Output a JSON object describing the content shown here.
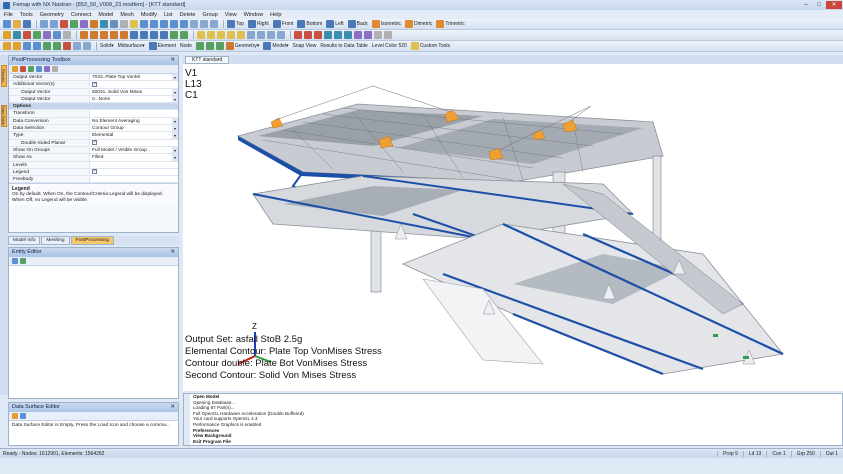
{
  "title": "Femap with NX Nastran - [853_50_V008_23.modfem] - [KTT standard]",
  "window_controls": {
    "minimize": "–",
    "maximize": "□",
    "close": "✕"
  },
  "menu": [
    "File",
    "Tools",
    "Geometry",
    "Connect",
    "Model",
    "Mesh",
    "Modify",
    "List",
    "Delete",
    "Group",
    "View",
    "Window",
    "Help"
  ],
  "toolbar1": {
    "views": [
      "Top",
      "Right",
      "Front",
      "Bottom",
      "Left",
      "Back",
      "Isometric",
      "Dimetric",
      "Trimetric"
    ]
  },
  "toolbar3": {
    "items": [
      "Solid",
      "Midsurface",
      "Element",
      "Node",
      "Geometry",
      "Model",
      "Snap View",
      "Results to Data Table",
      "Level Color 520",
      "Custom Tools"
    ]
  },
  "side_tabs": [
    "Results",
    "Data Table"
  ],
  "postprocessing_toolbox": {
    "title": "PostProcessing Toolbox",
    "rows": [
      {
        "key": "Output Vector",
        "value": "7033..Plate Top VonMi",
        "indent": false,
        "type": "text"
      },
      {
        "key": "Additional Vector(s)",
        "value": "",
        "indent": false,
        "type": "check"
      },
      {
        "key": "Output Vector",
        "value": "60031..Solid Von Mises",
        "indent": true,
        "type": "text"
      },
      {
        "key": "Output Vector",
        "value": "0...None",
        "indent": true,
        "type": "text"
      },
      {
        "key": "Options",
        "value": "",
        "indent": false,
        "type": "section"
      },
      {
        "key": "Transform",
        "value": "",
        "indent": false,
        "type": "text"
      },
      {
        "key": "Data Conversion",
        "value": "No Element Averaging",
        "indent": false,
        "type": "text"
      },
      {
        "key": "Data Selection",
        "value": "Contour Group",
        "indent": false,
        "type": "text"
      },
      {
        "key": "Type",
        "value": "Elemental",
        "indent": false,
        "type": "text"
      },
      {
        "key": "Double-Sided Planar",
        "value": "",
        "indent": true,
        "type": "check"
      },
      {
        "key": "Show On Groups",
        "value": "Full Model / Visible Group",
        "indent": false,
        "type": "text"
      },
      {
        "key": "Show As",
        "value": "Filled",
        "indent": false,
        "type": "text"
      },
      {
        "key": "Levels",
        "value": "",
        "indent": false,
        "type": "text"
      },
      {
        "key": "Legend",
        "value": "",
        "indent": false,
        "type": "check"
      },
      {
        "key": "Freebody",
        "value": "",
        "indent": false,
        "type": "text"
      }
    ],
    "help_title": "Legend",
    "help_text": "On by default. When On, the Contour/Criteria Legend will be displayed. When Off, no Legend will be visible."
  },
  "panel_tabs": [
    "Model Info",
    "Meshing",
    "PostProcessing"
  ],
  "entity_editor": {
    "title": "Entity Editor"
  },
  "data_surface_editor": {
    "title": "Data Surface Editor",
    "text": "Data Surface Editor is Empty. Press the Load Icon and choose a comma..."
  },
  "viewport": {
    "tab": "KTT standard",
    "corner_lines": [
      "V1",
      "L13",
      "C1"
    ],
    "legend_lines": [
      "Output Set: asfall StoB 2.5g",
      "Elemental Contour: Plate Top VonMises Stress",
      "Contour double: Plate Bot VonMises Stress",
      "Second Contour: Solid Von Mises Stress"
    ],
    "axis_z": "Z"
  },
  "messages": {
    "lines": [
      {
        "text": "Open Model",
        "bold": true
      },
      {
        "text": "Opening Database...",
        "bold": false
      },
      {
        "text": "Loading 87 Part(s)...",
        "bold": false
      },
      {
        "text": "Full OpenGL Hardware Acceleration (Double Buffered)",
        "bold": false
      },
      {
        "text": "Your card supports OpenGL 4.3",
        "bold": false
      },
      {
        "text": "Performance Graphics is enabled",
        "bold": false
      },
      {
        "text": "Preferences",
        "bold": true
      },
      {
        "text": "View Background",
        "bold": true
      },
      {
        "text": "Exit Program File",
        "bold": true
      }
    ]
  },
  "status": {
    "left": "Ready - Nodes: 1612901, Elements: 1564282",
    "cells": [
      "Prop 9",
      "Ld 13",
      "Con 1",
      "Grp 250",
      "Out 1"
    ]
  },
  "colors": {
    "accent_orange": "#f0a030",
    "titlebar": "#c7d7ec",
    "mesh_blue": "#1c4fa8"
  }
}
